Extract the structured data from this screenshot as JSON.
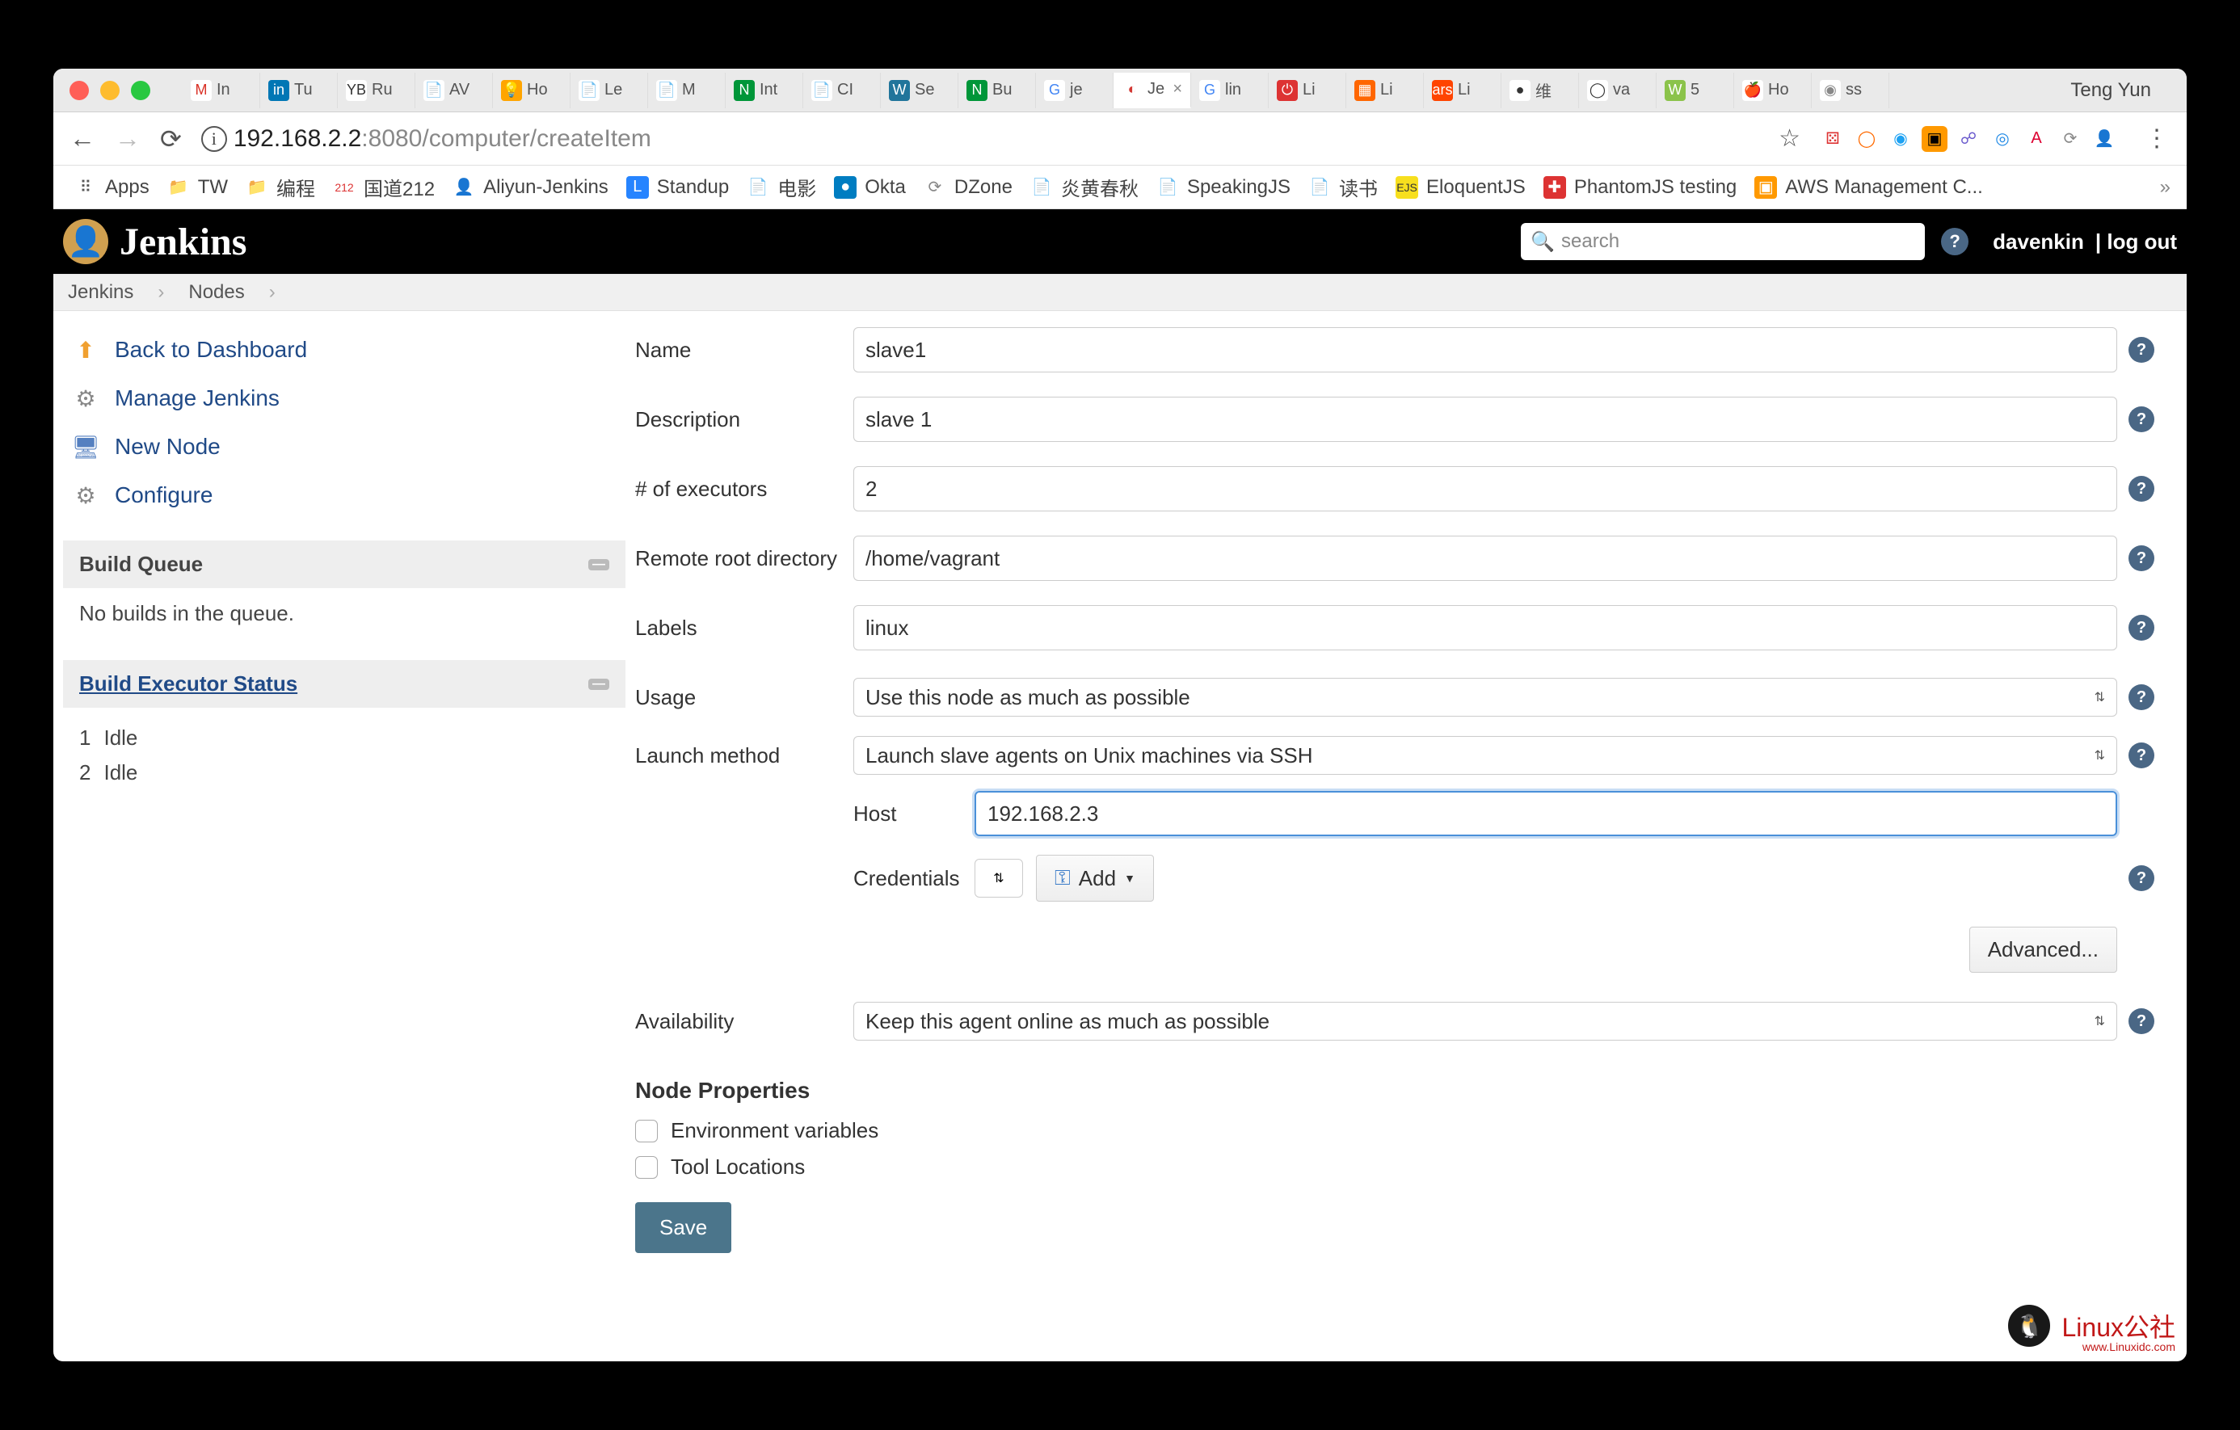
{
  "browser": {
    "user": "Teng Yun",
    "url_host": "192.168.2.2",
    "url_port": ":8080",
    "url_path": "/computer/createItem",
    "tabs": [
      {
        "label": "In",
        "ico": "M",
        "bg": "#fff",
        "fg": "#d93025",
        "name": "gmail"
      },
      {
        "label": "Tu",
        "ico": "in",
        "bg": "#0077b5",
        "fg": "#fff",
        "name": "linkedin"
      },
      {
        "label": "Ru",
        "ico": "YB",
        "bg": "#fff",
        "fg": "#333",
        "name": "yb"
      },
      {
        "label": "AV",
        "ico": "📄",
        "bg": "#fff",
        "fg": "#666",
        "name": "doc1"
      },
      {
        "label": "Ho",
        "ico": "💡",
        "bg": "#ffa500",
        "fg": "#fff",
        "name": "bulb"
      },
      {
        "label": "Le",
        "ico": "📄",
        "bg": "#fff",
        "fg": "#666",
        "name": "doc2"
      },
      {
        "label": "M",
        "ico": "📄",
        "bg": "#fff",
        "fg": "#666",
        "name": "doc3"
      },
      {
        "label": "Int",
        "ico": "N",
        "bg": "#009639",
        "fg": "#fff",
        "name": "nginx"
      },
      {
        "label": "CI",
        "ico": "📄",
        "bg": "#fff",
        "fg": "#666",
        "name": "doc4"
      },
      {
        "label": "Se",
        "ico": "W",
        "bg": "#21759b",
        "fg": "#fff",
        "name": "wp"
      },
      {
        "label": "Bu",
        "ico": "N",
        "bg": "#009639",
        "fg": "#fff",
        "name": "nginx2"
      },
      {
        "label": "je",
        "ico": "G",
        "bg": "#fff",
        "fg": "#4285f4",
        "name": "google1"
      },
      {
        "label": "Je",
        "ico": "◐",
        "bg": "#fff",
        "fg": "#d33833",
        "name": "jenkins-tab",
        "active": true
      },
      {
        "label": "lin",
        "ico": "G",
        "bg": "#fff",
        "fg": "#4285f4",
        "name": "google2"
      },
      {
        "label": "Li",
        "ico": "⏻",
        "bg": "#d33",
        "fg": "#fff",
        "name": "power"
      },
      {
        "label": "Li",
        "ico": "▦",
        "bg": "#f60",
        "fg": "#fff",
        "name": "orange"
      },
      {
        "label": "Li",
        "ico": "ars",
        "bg": "#f40",
        "fg": "#fff",
        "name": "ars"
      },
      {
        "label": "维",
        "ico": "●",
        "bg": "#fff",
        "fg": "#333",
        "name": "wiki"
      },
      {
        "label": "va",
        "ico": "◯",
        "bg": "#fff",
        "fg": "#333",
        "name": "github"
      },
      {
        "label": "5",
        "ico": "W",
        "bg": "#8bc34a",
        "fg": "#fff",
        "name": "wgreen"
      },
      {
        "label": "Ho",
        "ico": "🍎",
        "bg": "#fff",
        "fg": "#888",
        "name": "apple"
      },
      {
        "label": "ss",
        "ico": "◉",
        "bg": "#fff",
        "fg": "#888",
        "name": "ss"
      }
    ],
    "bookmarks": [
      {
        "label": "Apps",
        "ico": "⠿",
        "bg": "",
        "fg": "#555"
      },
      {
        "label": "TW",
        "ico": "📁",
        "bg": "",
        "fg": "#888"
      },
      {
        "label": "编程",
        "ico": "📁",
        "bg": "",
        "fg": "#888"
      },
      {
        "label": "国道212",
        "ico": "212",
        "bg": "",
        "fg": "#d33"
      },
      {
        "label": "Aliyun-Jenkins",
        "ico": "👤",
        "bg": "",
        "fg": "#555"
      },
      {
        "label": "Standup",
        "ico": "L",
        "bg": "#2684ff",
        "fg": "#fff"
      },
      {
        "label": "电影",
        "ico": "📄",
        "bg": "",
        "fg": "#888"
      },
      {
        "label": "Okta",
        "ico": "●",
        "bg": "#007dc1",
        "fg": "#fff"
      },
      {
        "label": "DZone",
        "ico": "⟳",
        "bg": "",
        "fg": "#888"
      },
      {
        "label": "炎黄春秋",
        "ico": "📄",
        "bg": "",
        "fg": "#888"
      },
      {
        "label": "SpeakingJS",
        "ico": "📄",
        "bg": "",
        "fg": "#888"
      },
      {
        "label": "读书",
        "ico": "📄",
        "bg": "",
        "fg": "#888"
      },
      {
        "label": "EloquentJS",
        "ico": "EJS",
        "bg": "#f7df1e",
        "fg": "#333"
      },
      {
        "label": "PhantomJS testing",
        "ico": "✚",
        "bg": "#d33",
        "fg": "#fff"
      },
      {
        "label": "AWS Management C...",
        "ico": "▣",
        "bg": "#f90",
        "fg": "#fff"
      }
    ]
  },
  "jenkins": {
    "title": "Jenkins",
    "search_placeholder": "search",
    "user": "davenkin",
    "logout": "| log out",
    "breadcrumbs": [
      "Jenkins",
      "Nodes"
    ],
    "side_links": [
      {
        "label": "Back to Dashboard",
        "ico": "⬆",
        "color": "#f0a030"
      },
      {
        "label": "Manage Jenkins",
        "ico": "⚙",
        "color": "#888"
      },
      {
        "label": "New Node",
        "ico": "🖥",
        "color": "#5580c0"
      },
      {
        "label": "Configure",
        "ico": "⚙",
        "color": "#888"
      }
    ],
    "build_queue": {
      "title": "Build Queue",
      "empty": "No builds in the queue."
    },
    "executor": {
      "title": "Build Executor Status",
      "rows": [
        {
          "n": "1",
          "s": "Idle"
        },
        {
          "n": "2",
          "s": "Idle"
        }
      ]
    },
    "form": {
      "name": {
        "label": "Name",
        "value": "slave1"
      },
      "description": {
        "label": "Description",
        "value": "slave 1"
      },
      "executors": {
        "label": "# of executors",
        "value": "2"
      },
      "rootdir": {
        "label": "Remote root directory",
        "value": "/home/vagrant"
      },
      "labels": {
        "label": "Labels",
        "value": "linux"
      },
      "usage": {
        "label": "Usage",
        "value": "Use this node as much as possible"
      },
      "launch": {
        "label": "Launch method",
        "value": "Launch slave agents on Unix machines via SSH"
      },
      "host": {
        "label": "Host",
        "value": "192.168.2.3"
      },
      "credentials": {
        "label": "Credentials",
        "add": "Add"
      },
      "advanced": "Advanced...",
      "availability": {
        "label": "Availability",
        "value": "Keep this agent online as much as possible"
      },
      "props_title": "Node Properties",
      "props": [
        "Environment variables",
        "Tool Locations"
      ],
      "save": "Save"
    }
  },
  "watermark": {
    "text": "Linux公社",
    "sub": "www.Linuxidc.com"
  }
}
